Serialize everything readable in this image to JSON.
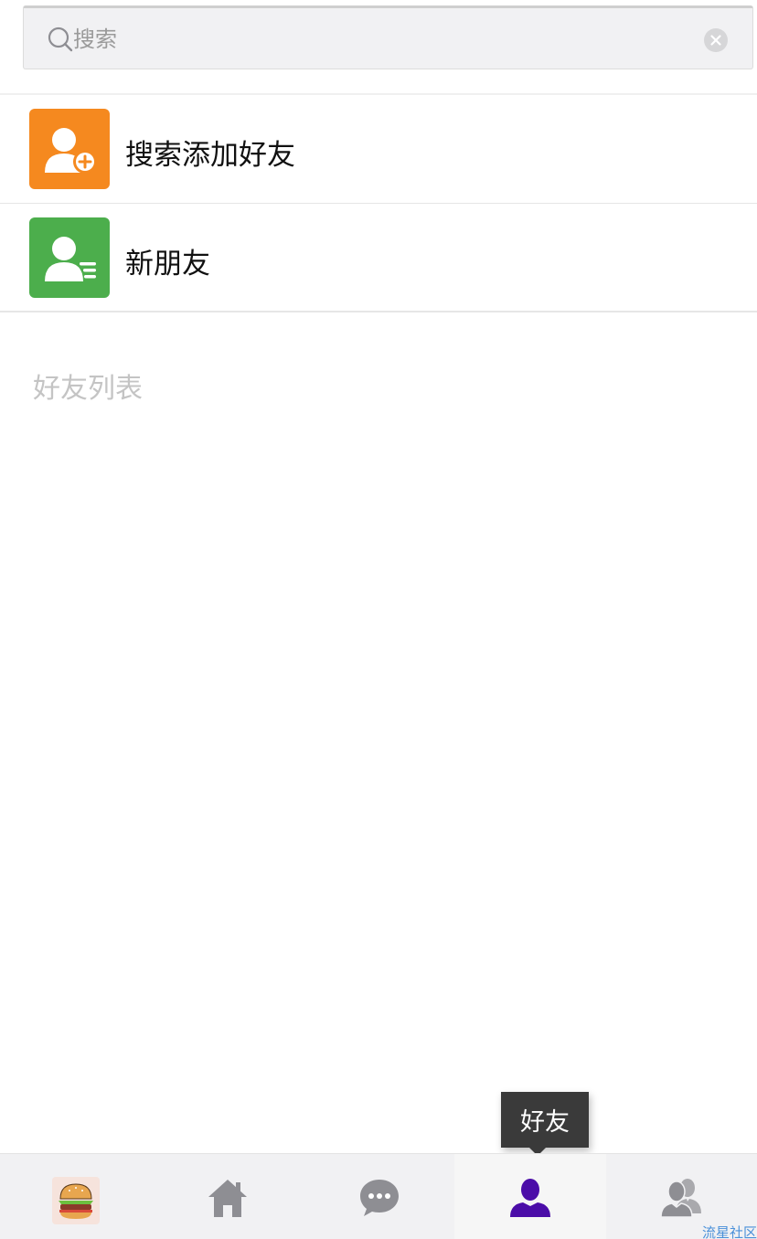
{
  "search": {
    "placeholder": "搜索",
    "value": ""
  },
  "rows": [
    {
      "label": "搜索添加好友",
      "icon": "add-friend-icon",
      "color": "#f5891f"
    },
    {
      "label": "新朋友",
      "icon": "new-friends-icon",
      "color": "#4cae4c"
    }
  ],
  "section_title": "好友列表",
  "tooltip": {
    "label": "好友"
  },
  "tabbar": {
    "tabs": [
      {
        "name": "avatar",
        "icon": "burger-avatar"
      },
      {
        "name": "home",
        "icon": "home-icon"
      },
      {
        "name": "chat",
        "icon": "chat-icon"
      },
      {
        "name": "friends",
        "icon": "person-icon",
        "active": true
      },
      {
        "name": "groups",
        "icon": "group-icon"
      }
    ],
    "active_color": "#4b0da8",
    "inactive_color": "#8e8e93"
  },
  "watermark": "流星社区"
}
